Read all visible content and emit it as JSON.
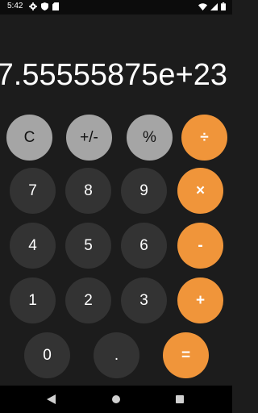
{
  "status": {
    "time": "5:42",
    "left_icons": [
      "gear-icon",
      "shield-icon",
      "sd-card-icon"
    ],
    "right_icons": [
      "wifi-icon",
      "signal-icon",
      "battery-icon"
    ]
  },
  "display": {
    "value": "7.55555875e+23"
  },
  "keys": {
    "clear": "C",
    "sign": "+/-",
    "percent": "%",
    "divide": "÷",
    "seven": "7",
    "eight": "8",
    "nine": "9",
    "multiply": "×",
    "four": "4",
    "five": "5",
    "six": "6",
    "minus": "-",
    "one": "1",
    "two": "2",
    "three": "3",
    "plus": "+",
    "zero": "0",
    "decimal": ".",
    "equals": "="
  },
  "colors": {
    "background": "#1c1c1c",
    "function_key": "#a5a5a5",
    "digit_key": "#333333",
    "operator_key": "#f0953a"
  },
  "nav": {
    "icons": [
      "back-icon",
      "home-icon",
      "recents-icon"
    ]
  }
}
